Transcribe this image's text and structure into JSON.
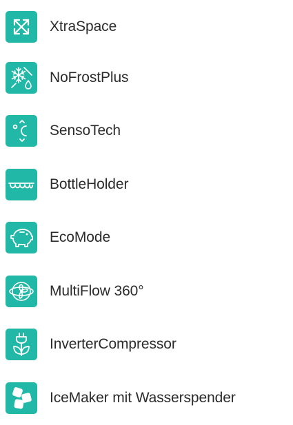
{
  "features": [
    {
      "label": "XtraSpace",
      "icon": "expand-arrows-icon"
    },
    {
      "label": "NoFrostPlus",
      "icon": "snowflake-drop-icon"
    },
    {
      "label": "SensoTech",
      "icon": "temperature-sensor-icon"
    },
    {
      "label": "BottleHolder",
      "icon": "bottle-holder-icon"
    },
    {
      "label": "EcoMode",
      "icon": "piggy-bank-icon"
    },
    {
      "label": "MultiFlow 360°",
      "icon": "fan-airflow-icon"
    },
    {
      "label": "InverterCompressor",
      "icon": "plug-leaf-icon"
    },
    {
      "label": "IceMaker mit Wasserspender",
      "icon": "ice-cubes-icon"
    }
  ],
  "colors": {
    "icon_background": "#22b8a8",
    "icon_foreground": "#ffffff",
    "label_text": "#2b2b2b"
  }
}
